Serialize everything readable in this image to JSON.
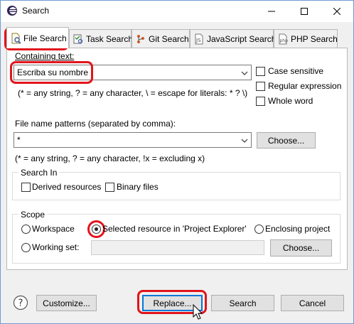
{
  "window": {
    "title": "Search"
  },
  "tabs": [
    {
      "label": "File Search",
      "icon": "file-search-icon",
      "active": true
    },
    {
      "label": "Task Search",
      "icon": "task-search-icon"
    },
    {
      "label": "Git Search",
      "icon": "git-search-icon"
    },
    {
      "label": "JavaScript Search",
      "icon": "javascript-search-icon"
    },
    {
      "label": "PHP Search",
      "icon": "php-search-icon"
    }
  ],
  "containing_text": {
    "label": "Containing text:",
    "value": "Escriba su nombre",
    "hint": "(* = any string, ? = any character, \\ = escape for literals: * ? \\)",
    "options": {
      "case_sensitive": "Case sensitive",
      "regex": "Regular expression",
      "whole_word": "Whole word"
    }
  },
  "file_patterns": {
    "label": "File name patterns (separated by comma):",
    "value": "*",
    "choose_label": "Choose...",
    "hint": "(* = any string, ? = any character, !x = excluding x)"
  },
  "search_in": {
    "title": "Search In",
    "derived": "Derived resources",
    "binary": "Binary files"
  },
  "scope": {
    "title": "Scope",
    "workspace": "Workspace",
    "selected": "Selected resource in 'Project Explorer'",
    "enclosing": "Enclosing project",
    "working_set": "Working set:",
    "choose_label": "Choose..."
  },
  "footer": {
    "customize": "Customize...",
    "replace": "Replace...",
    "search": "Search",
    "cancel": "Cancel"
  },
  "colors": {
    "highlight": "#e2141c",
    "accent": "#0078d7"
  }
}
